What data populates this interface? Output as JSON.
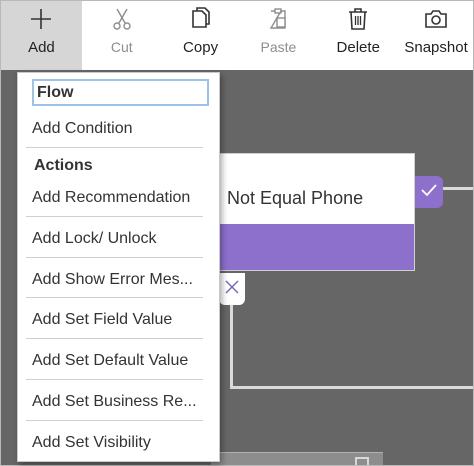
{
  "toolbar": {
    "add": "Add",
    "cut": "Cut",
    "copy": "Copy",
    "paste": "Paste",
    "delete": "Delete",
    "snapshot": "Snapshot"
  },
  "icons": {
    "add": "plus-icon",
    "cut": "scissors-icon",
    "copy": "copy-icon",
    "paste": "clipboard-icon",
    "delete": "trash-icon",
    "snapshot": "camera-icon"
  },
  "menu": {
    "flow_label": "Flow",
    "add_condition": "Add Condition",
    "actions_label": "Actions",
    "items": [
      "Add Recommendation",
      "Add Lock/ Unlock",
      "Add Show Error Mes...",
      "Add Set Field Value",
      "Add Set Default Value",
      "Add Set Business Re...",
      "Add Set Visibility"
    ]
  },
  "canvas": {
    "node_text": "Not Equal Phone"
  },
  "colors": {
    "accent": "#8d70cc",
    "canvas": "#666666",
    "toolbar_active": "#d6d6d6",
    "focus_border": "#9fc3e7"
  }
}
